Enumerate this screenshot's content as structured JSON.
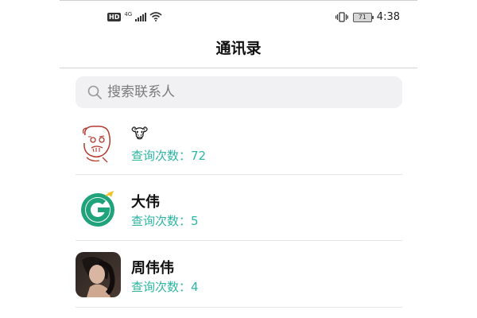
{
  "status_bar": {
    "hd": "HD",
    "network": "4G",
    "battery": "71",
    "time": "4:38"
  },
  "header": {
    "title": "通讯录"
  },
  "search": {
    "placeholder": "搜索联系人"
  },
  "contacts": [
    {
      "name": "🐮",
      "stats_label": "查询次数：",
      "count": "72",
      "avatar": "doodle-face"
    },
    {
      "name": "大伟",
      "stats_label": "查询次数：",
      "count": "5",
      "avatar": "green-g-logo"
    },
    {
      "name": "周伟伟",
      "stats_label": "查询次数：",
      "count": "4",
      "avatar": "photo"
    }
  ],
  "colors": {
    "accent": "#2cb6a3",
    "search_bg": "#f1f1f3",
    "divider": "#e6e6e6"
  }
}
